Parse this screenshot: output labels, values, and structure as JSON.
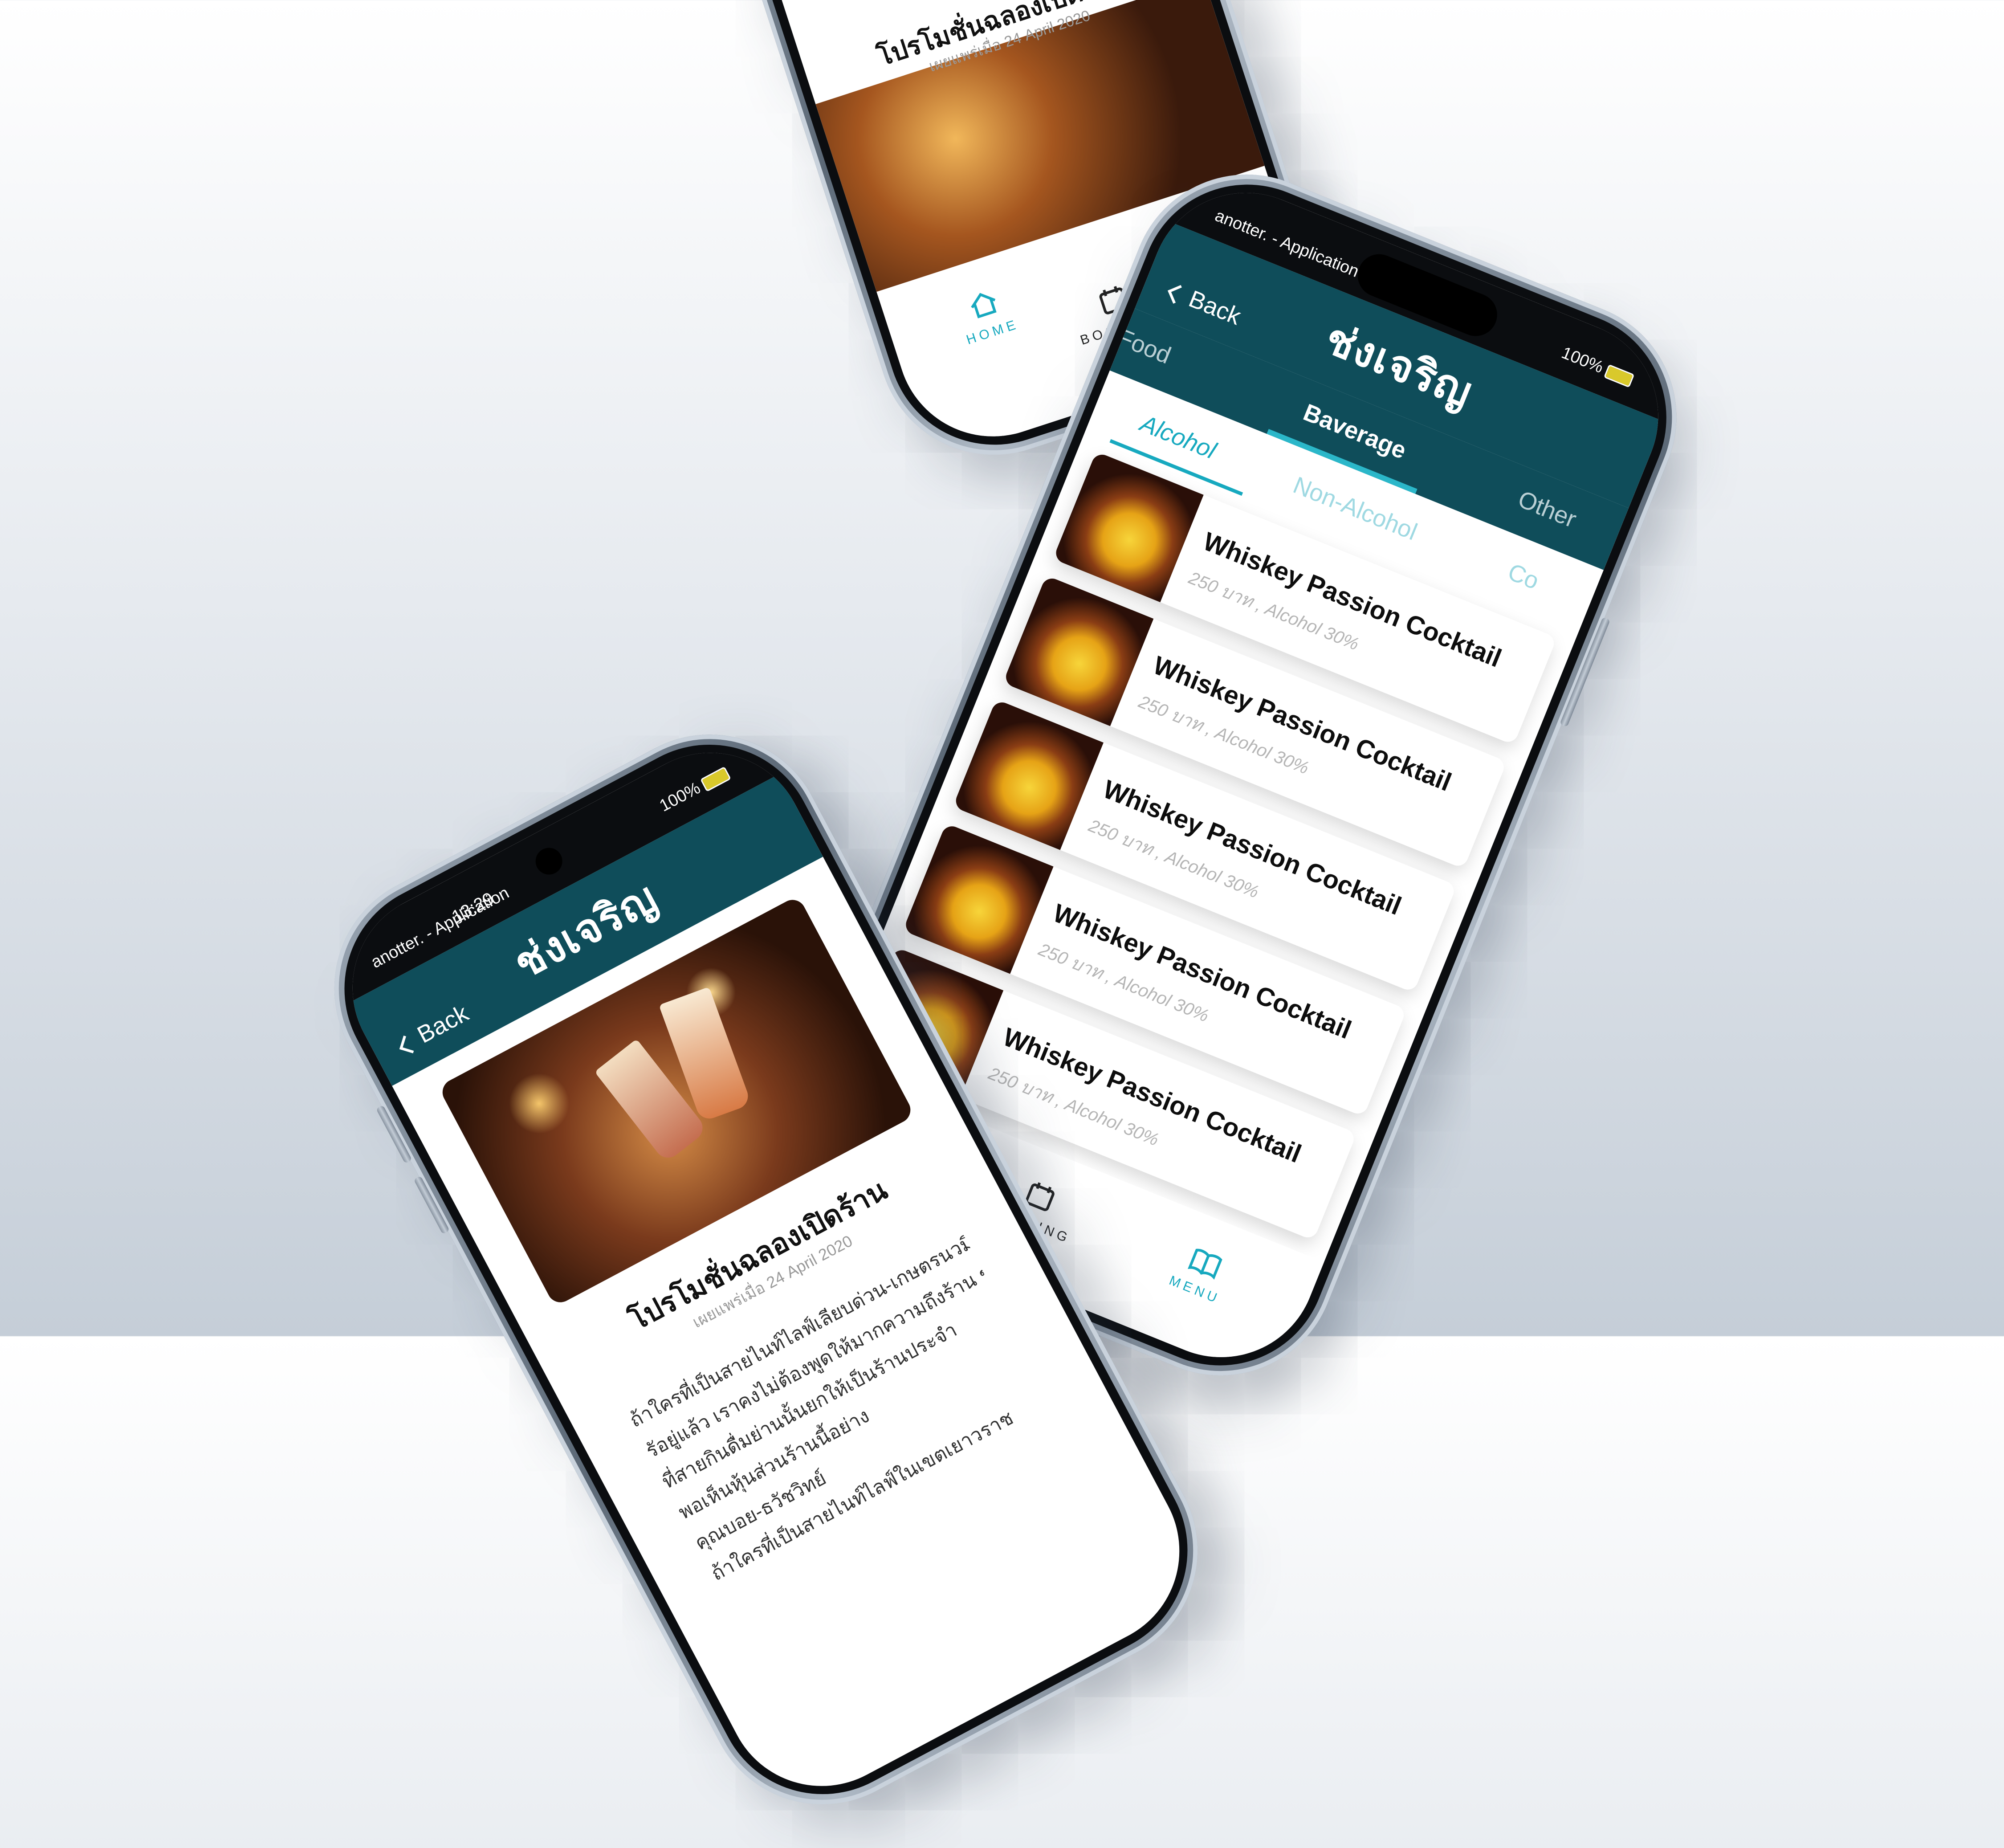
{
  "app": {
    "carrier": "anotter. - Application",
    "time": "13:29",
    "battery": "100%",
    "brand_logo": "ช่งเจริญ",
    "back_label": "Back",
    "colors": {
      "header": "#0f4d5a",
      "accent": "#17a9bf"
    }
  },
  "menu_screen": {
    "tabs": [
      {
        "label": "Food"
      },
      {
        "label": "Baverage"
      },
      {
        "label": "Other"
      }
    ],
    "subtabs": [
      {
        "label": "Alcohol"
      },
      {
        "label": "Non-Alcohol"
      },
      {
        "label": "Co"
      }
    ],
    "items": [
      {
        "name": "Whiskey Passion Cocktail",
        "meta": "250 บาท , Alcohol 30%"
      },
      {
        "name": "Whiskey Passion Cocktail",
        "meta": "250 บาท , Alcohol 30%"
      },
      {
        "name": "Whiskey Passion Cocktail",
        "meta": "250 บาท , Alcohol 30%"
      },
      {
        "name": "Whiskey Passion Cocktail",
        "meta": "250 บาท , Alcohol 30%"
      },
      {
        "name": "Whiskey Passion Cocktail",
        "meta": "250 บาท , Alcohol 30%"
      }
    ]
  },
  "nav": {
    "home": "HOME",
    "booking": "BOOKING",
    "menu": "MENU"
  },
  "article": {
    "title": "โปรโมชั่นฉลองเปิดร้าน",
    "date": "เผยแพร่เมื่อ 24 April 2020",
    "body_lines": [
      "ถ้าใครที่เป็นสายไนท์ไลฟ์ในเขตเยาวราช",
      "ถ้าใครที่เป็นสายไนท์ไลฟ์เลียบด่วน-เกษตรนวมินท",
      "รัอยู่แล้ว เราคงไม่ต้องพูดให้มากความถึงร้าน ชงเจริญ",
      "ที่สายกินดื่มย่านนั้นยกให้เป็นร้านประจำ",
      "พอเห็นหุ้นส่วนร้านนี้อย่าง",
      "คุณบอย-ธวัชวิทย์"
    ]
  }
}
